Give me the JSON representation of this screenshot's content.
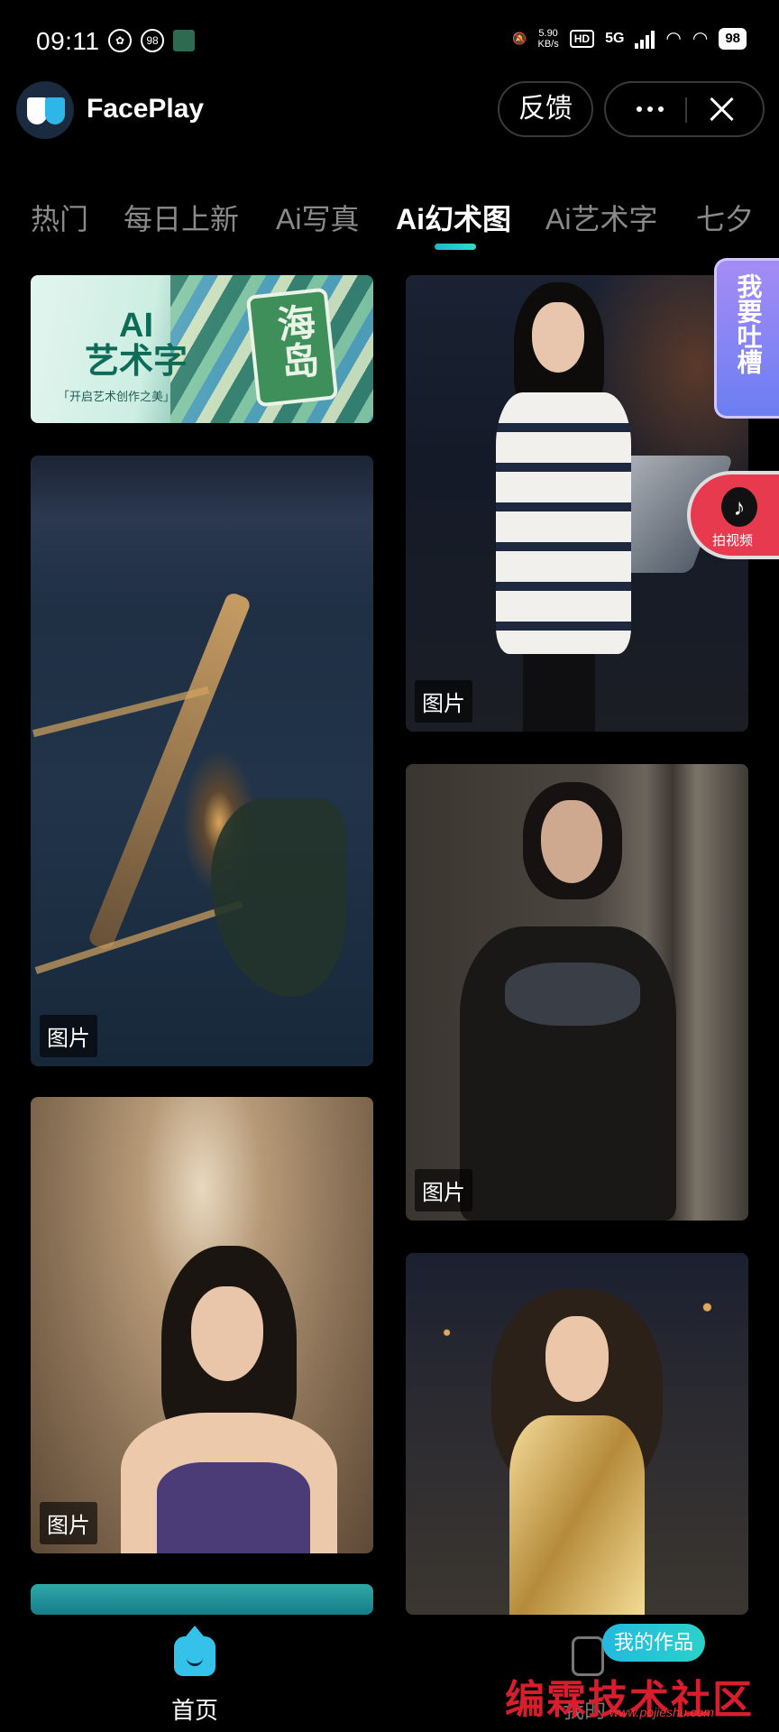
{
  "status_bar": {
    "time": "09:11",
    "notif_count": "98",
    "net_speed_value": "5.90",
    "net_speed_unit": "KB/s",
    "hd": "HD",
    "network": "5G",
    "battery": "98"
  },
  "header": {
    "app_name": "FacePlay",
    "feedback_label": "反馈"
  },
  "tabs": [
    {
      "label": "热门",
      "active": false
    },
    {
      "label": "每日上新",
      "active": false
    },
    {
      "label": "Ai写真",
      "active": false
    },
    {
      "label": "Ai幻术图",
      "active": true
    },
    {
      "label": "Ai艺术字",
      "active": false
    },
    {
      "label": "七夕",
      "active": false
    }
  ],
  "banner": {
    "title_line1": "AI",
    "title_line2": "艺术字",
    "subtitle": "「开启艺术创作之美」",
    "island_text": "海岛"
  },
  "cards": {
    "city_label": "图片",
    "girl_white_label": "图片",
    "girl_black_label": "图片",
    "girl_purple_label": "图片"
  },
  "side": {
    "feedback_tab": "我要吐槽",
    "tiktok_label": "拍视频"
  },
  "bottom_nav": {
    "home_label": "首页",
    "works_label": "我的",
    "works_tooltip": "我的作品"
  },
  "watermark": {
    "text": "编霖技术社区",
    "url": "www.pojieshu.com"
  },
  "colors": {
    "accent": "#29c6d6",
    "background": "#000000",
    "tab_inactive": "#8a8a8a"
  }
}
